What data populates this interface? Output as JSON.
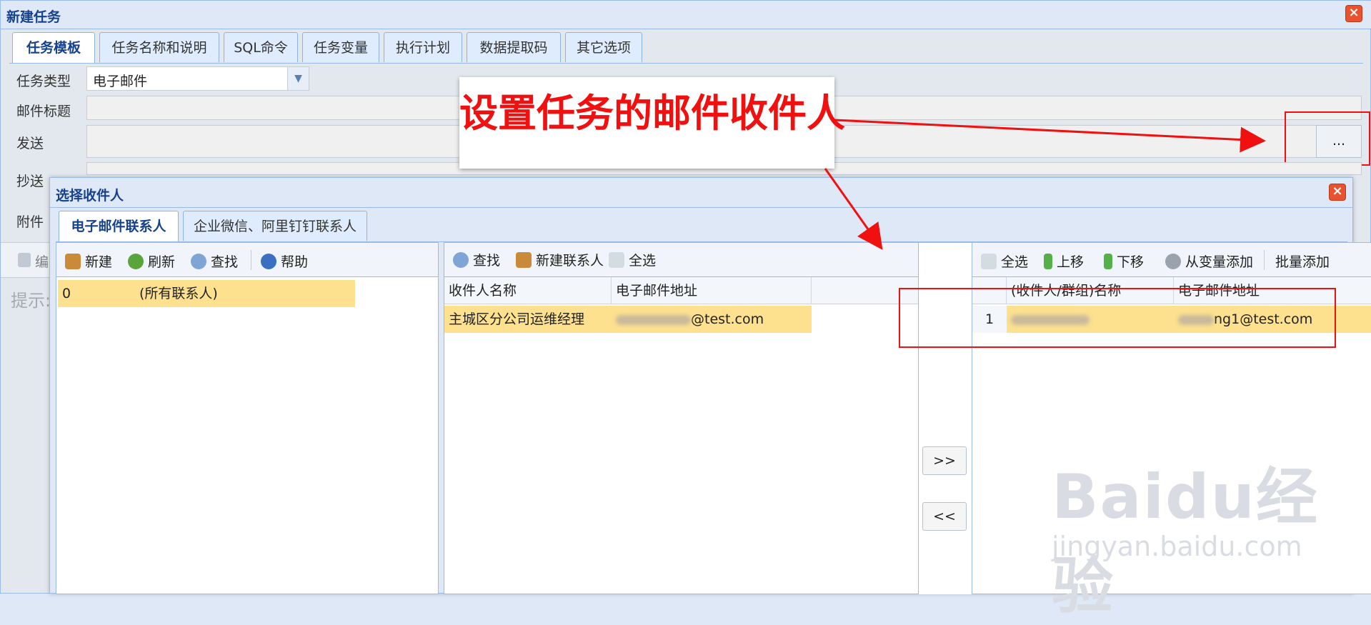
{
  "window": {
    "title": "新建任务"
  },
  "tabs": [
    "任务模板",
    "任务名称和说明",
    "SQL命令",
    "任务变量",
    "执行计划",
    "数据提取码",
    "其它选项"
  ],
  "form": {
    "task_type_label": "任务类型",
    "task_type_value": "电子邮件",
    "mail_subject_label": "邮件标题",
    "send_label": "发送",
    "cc_label": "抄送",
    "attachment_label": "附件",
    "browse_button": "...",
    "edit_label": "编",
    "hint_label": "提示:"
  },
  "callout": {
    "text": "设置任务的邮件收件人"
  },
  "dialog": {
    "title": "选择收件人",
    "tabs": [
      "电子邮件联系人",
      "企业微信、阿里钉钉联系人"
    ],
    "left": {
      "toolbar": {
        "new": "新建",
        "refresh": "刷新",
        "find": "查找",
        "help": "帮助"
      },
      "groups": [
        {
          "id": "0",
          "name": "(所有联系人)"
        }
      ]
    },
    "middle": {
      "toolbar": {
        "find": "查找",
        "new_contact": "新建联系人",
        "select_all": "全选"
      },
      "columns": [
        "收件人名称",
        "电子邮件地址"
      ],
      "rows": [
        {
          "name": "主城区分公司运维经理",
          "email_suffix": "@test.com"
        }
      ]
    },
    "transfer": {
      "add": ">>",
      "remove": "<<"
    },
    "right": {
      "toolbar": {
        "select_all": "全选",
        "move_up": "上移",
        "move_down": "下移",
        "from_variable": "从变量添加",
        "batch_add": "批量添加"
      },
      "columns": [
        "(收件人/群组)名称",
        "电子邮件地址"
      ],
      "rows": [
        {
          "index": "1",
          "email_suffix": "ng1@test.com"
        }
      ]
    }
  },
  "watermark": {
    "brand": "Baidu经验",
    "url": "jingyan.baidu.com"
  },
  "colors": {
    "accent": "#15428b",
    "selection": "#fde18f",
    "highlight": "#f01010"
  }
}
